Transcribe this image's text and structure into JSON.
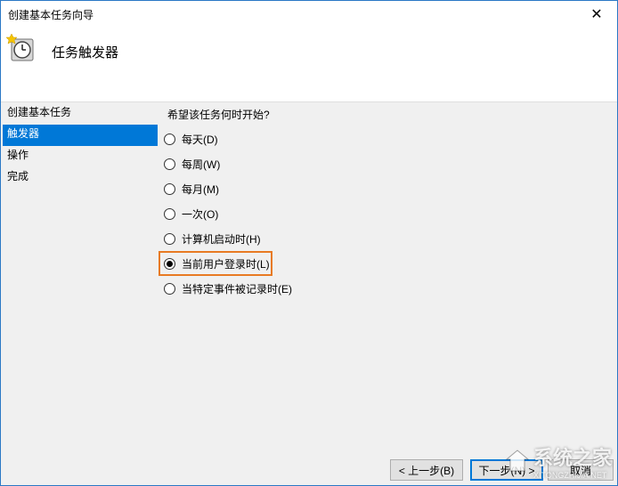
{
  "window": {
    "title": "创建基本任务向导",
    "close_symbol": "✕"
  },
  "header": {
    "title": "任务触发器",
    "icon": "clock-icon"
  },
  "nav": {
    "items": [
      {
        "label": "创建基本任务",
        "active": false
      },
      {
        "label": "触发器",
        "active": true
      },
      {
        "label": "操作",
        "active": false
      },
      {
        "label": "完成",
        "active": false
      }
    ]
  },
  "trigger": {
    "question": "希望该任务何时开始?",
    "options": [
      {
        "label": "每天(D)",
        "checked": false
      },
      {
        "label": "每周(W)",
        "checked": false
      },
      {
        "label": "每月(M)",
        "checked": false
      },
      {
        "label": "一次(O)",
        "checked": false
      },
      {
        "label": "计算机启动时(H)",
        "checked": false
      },
      {
        "label": "当前用户登录时(L)",
        "checked": true
      },
      {
        "label": "当特定事件被记录时(E)",
        "checked": false
      }
    ],
    "highlight_color": "#e87a23"
  },
  "footer": {
    "back_label": "< 上一步(B)",
    "next_label": "下一步(N) >",
    "cancel_label": "取消"
  },
  "watermark": {
    "text": "系统之家",
    "url": "XITONGZHIJIA.NET"
  },
  "colors": {
    "accent": "#0078d7",
    "highlight": "#e87a23"
  }
}
